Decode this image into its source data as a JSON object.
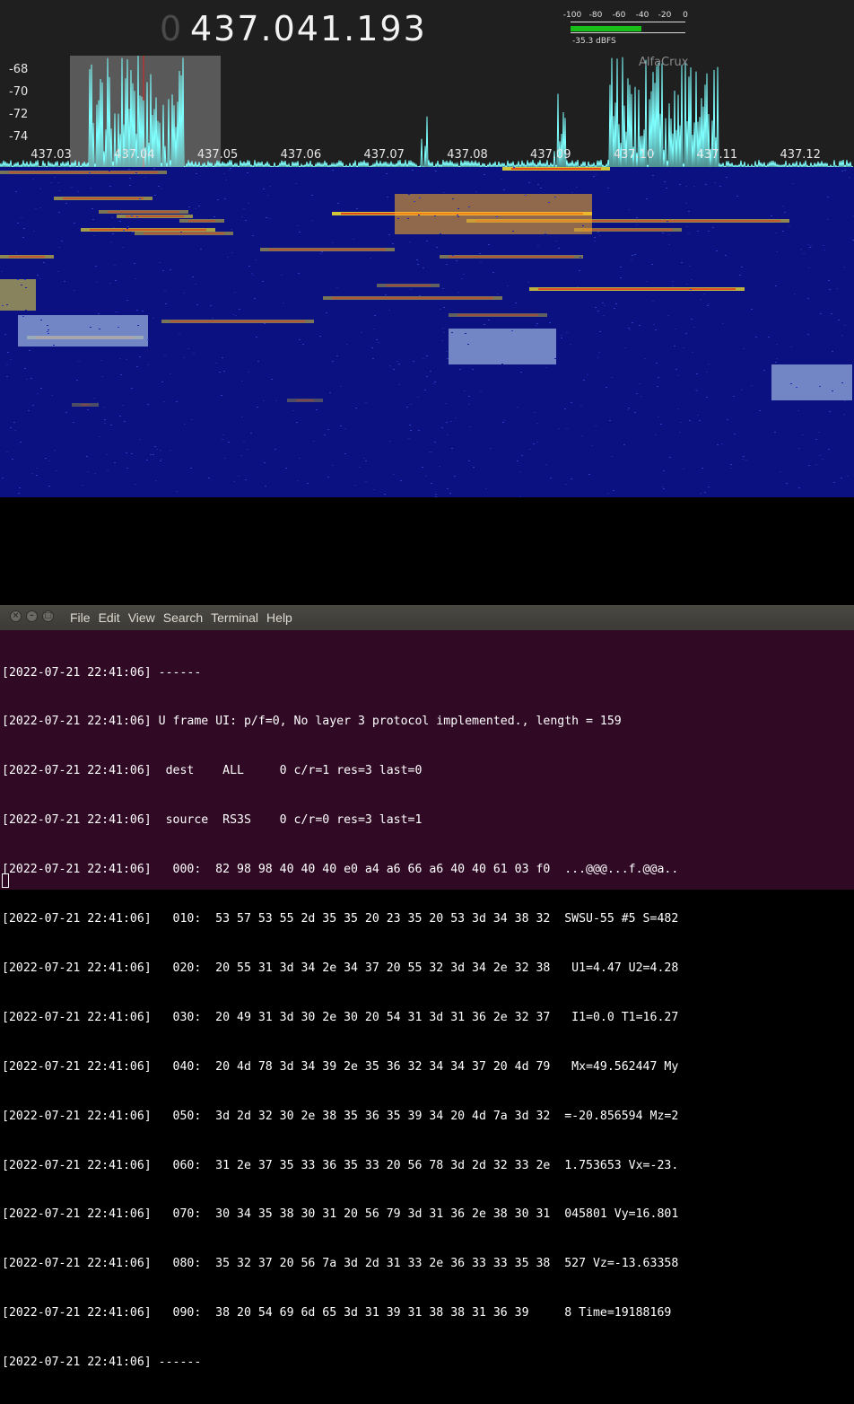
{
  "sdr": {
    "frequency_lead": "0",
    "frequency": "437.041.193",
    "meter": {
      "ticks": [
        "-100",
        "-80",
        "-60",
        "-40",
        "-20",
        "0"
      ],
      "level_fraction": 0.62,
      "reading": "-35.3 dBFS",
      "bar_color": "#19c019"
    },
    "station_label": "AlfaCrux",
    "db_labels": [
      "-68",
      "-70",
      "-72",
      "-74"
    ],
    "freq_labels": [
      "437.03",
      "437.04",
      "437.05",
      "437.06",
      "437.07",
      "437.08",
      "437.09",
      "437.10",
      "437.11",
      "437.12"
    ],
    "trace_color": "#7fffff",
    "selection_color": "#6e6e6e"
  },
  "terminal": {
    "menu": [
      "File",
      "Edit",
      "View",
      "Search",
      "Terminal",
      "Help"
    ],
    "lines": [
      "[2022-07-21 22:41:06] ------",
      "[2022-07-21 22:41:06] U frame UI: p/f=0, No layer 3 protocol implemented., length = 159",
      "[2022-07-21 22:41:06]  dest    ALL     0 c/r=1 res=3 last=0",
      "[2022-07-21 22:41:06]  source  RS3S    0 c/r=0 res=3 last=1",
      "[2022-07-21 22:41:06]   000:  82 98 98 40 40 40 e0 a4 a6 66 a6 40 40 61 03 f0  ...@@@...f.@@a..",
      "[2022-07-21 22:41:06]   010:  53 57 53 55 2d 35 35 20 23 35 20 53 3d 34 38 32  SWSU-55 #5 S=482",
      "[2022-07-21 22:41:06]   020:  20 55 31 3d 34 2e 34 37 20 55 32 3d 34 2e 32 38   U1=4.47 U2=4.28",
      "[2022-07-21 22:41:06]   030:  20 49 31 3d 30 2e 30 20 54 31 3d 31 36 2e 32 37   I1=0.0 T1=16.27",
      "[2022-07-21 22:41:06]   040:  20 4d 78 3d 34 39 2e 35 36 32 34 34 37 20 4d 79   Mx=49.562447 My",
      "[2022-07-21 22:41:06]   050:  3d 2d 32 30 2e 38 35 36 35 39 34 20 4d 7a 3d 32  =-20.856594 Mz=2",
      "[2022-07-21 22:41:06]   060:  31 2e 37 35 33 36 35 33 20 56 78 3d 2d 32 33 2e  1.753653 Vx=-23.",
      "[2022-07-21 22:41:06]   070:  30 34 35 38 30 31 20 56 79 3d 31 36 2e 38 30 31  045801 Vy=16.801",
      "[2022-07-21 22:41:06]   080:  35 32 37 20 56 7a 3d 2d 31 33 2e 36 33 33 35 38  527 Vz=-13.63358",
      "[2022-07-21 22:41:06]   090:  38 20 54 69 6d 65 3d 31 39 31 38 38 31 36 39     8 Time=19188169",
      "[2022-07-21 22:41:06] ------"
    ]
  }
}
